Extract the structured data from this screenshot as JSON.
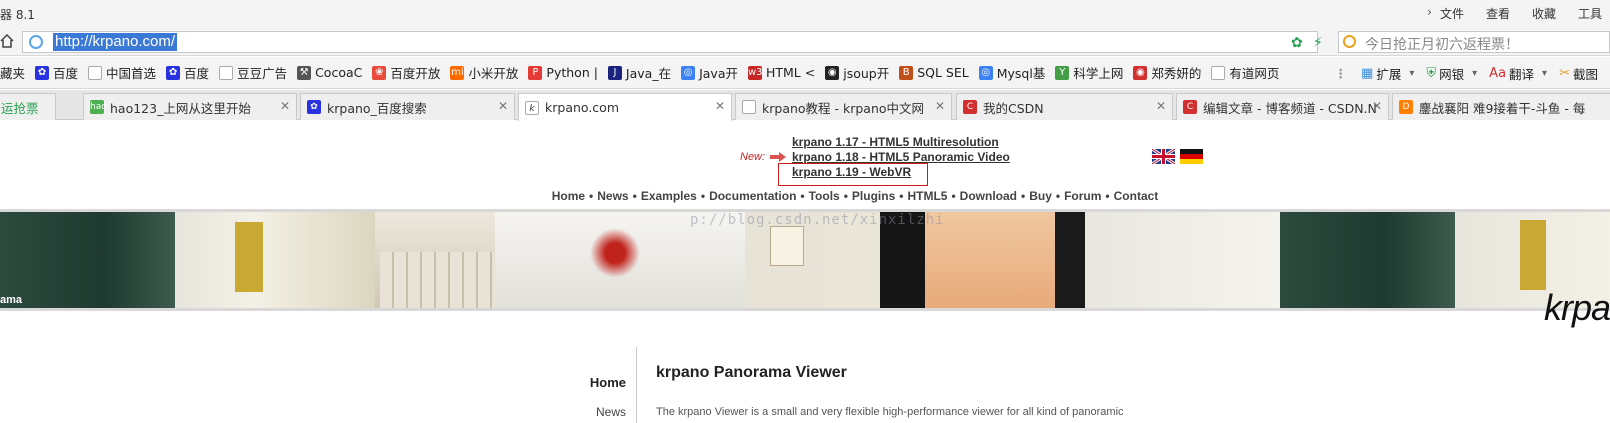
{
  "window": {
    "app_title": "器 8.1",
    "menu": [
      "文件",
      "查看",
      "收藏",
      "工具"
    ]
  },
  "address_bar": {
    "url": "http://krpano.com/",
    "search_placeholder": "今日抢正月初六返程票！"
  },
  "bookmarks": [
    {
      "label": "藏夹",
      "icon": "folder-icon",
      "color": "#f4f4f4"
    },
    {
      "label": "百度",
      "icon": "baidu-paw-icon",
      "color": "#2932e1"
    },
    {
      "label": "中国首选",
      "icon": "page-icon",
      "color": "#ffffff"
    },
    {
      "label": "百度",
      "icon": "baidu-paw-icon",
      "color": "#2932e1"
    },
    {
      "label": "豆豆广告",
      "icon": "page-icon",
      "color": "#ffffff"
    },
    {
      "label": "CocoaC",
      "icon": "hammer-icon",
      "color": "#555555"
    },
    {
      "label": "百度开放",
      "icon": "flower-icon",
      "color": "#e84c3d"
    },
    {
      "label": "小米开放",
      "icon": "mi-icon",
      "color": "#ff6a00"
    },
    {
      "label": "Python |",
      "icon": "p-icon",
      "color": "#e53935"
    },
    {
      "label": "Java_在",
      "icon": "j-icon",
      "color": "#1a237e"
    },
    {
      "label": "Java开",
      "icon": "globe-icon",
      "color": "#3b82f6"
    },
    {
      "label": "HTML <",
      "icon": "w3-icon",
      "color": "#c62828"
    },
    {
      "label": "jsoup开",
      "icon": "earth-icon",
      "color": "#222222"
    },
    {
      "label": "SQL SEL",
      "icon": "sql-icon",
      "color": "#c0501a"
    },
    {
      "label": "Mysql基",
      "icon": "globe-icon",
      "color": "#3b82f6"
    },
    {
      "label": "科学上网",
      "icon": "y-icon",
      "color": "#43a047"
    },
    {
      "label": "郑秀妍的",
      "icon": "weibo-icon",
      "color": "#d32f2f"
    },
    {
      "label": "有道网页",
      "icon": "page-icon",
      "color": "#ffffff"
    }
  ],
  "bookmarks_right": [
    {
      "label": "扩展",
      "icon": "grid-icon"
    },
    {
      "label": "网银",
      "icon": "shield-icon"
    },
    {
      "label": "翻译",
      "icon": "translate-icon"
    },
    {
      "label": "截图",
      "icon": "scissors-icon"
    }
  ],
  "tabs": [
    {
      "label": "运抢票",
      "icon": "none"
    },
    {
      "label": "hao123_上网从这里开始",
      "icon": "hao-icon",
      "color": "#4caf50"
    },
    {
      "label": "krpano_百度搜索",
      "icon": "baidu-paw-icon",
      "color": "#2932e1"
    },
    {
      "label": "krpano.com",
      "icon": "krpano-icon",
      "color": "#ffffff",
      "active": true
    },
    {
      "label": "krpano教程 - krpano中文网",
      "icon": "page-icon",
      "color": "#ffffff"
    },
    {
      "label": "我的CSDN",
      "icon": "csdn-icon",
      "color": "#d32f2f"
    },
    {
      "label": "编辑文章 - 博客频道 - CSDN.N",
      "icon": "csdn-icon",
      "color": "#d32f2f"
    },
    {
      "label": "鏖战襄阳 难9接着干-斗鱼 - 每",
      "icon": "douyu-icon",
      "color": "#ff7f00"
    }
  ],
  "page": {
    "news_label": "New:",
    "news_links": [
      "krpano 1.17 - HTML5 Multiresolution",
      "krpano 1.18 - HTML5 Panoramic Video",
      "krpano 1.19 - WebVR"
    ],
    "nav": [
      "Home",
      "News",
      "Examples",
      "Documentation",
      "Tools",
      "Plugins",
      "HTML5",
      "Download",
      "Buy",
      "Forum",
      "Contact"
    ],
    "banner_caption": "ama",
    "banner_watermark": "p://blog.csdn.net/xinxilzhi",
    "logo_text": "krpa",
    "side_nav": [
      "Home",
      "News"
    ],
    "content_title": "krpano Panorama Viewer",
    "content_text_partial": "The krpano Viewer is a small and very flexible high-performance viewer for all kind of panoramic"
  },
  "colors": {
    "accent_url_selection": "#3a79d6",
    "highlight_box": "#d01818",
    "new_label": "#cc2222"
  }
}
